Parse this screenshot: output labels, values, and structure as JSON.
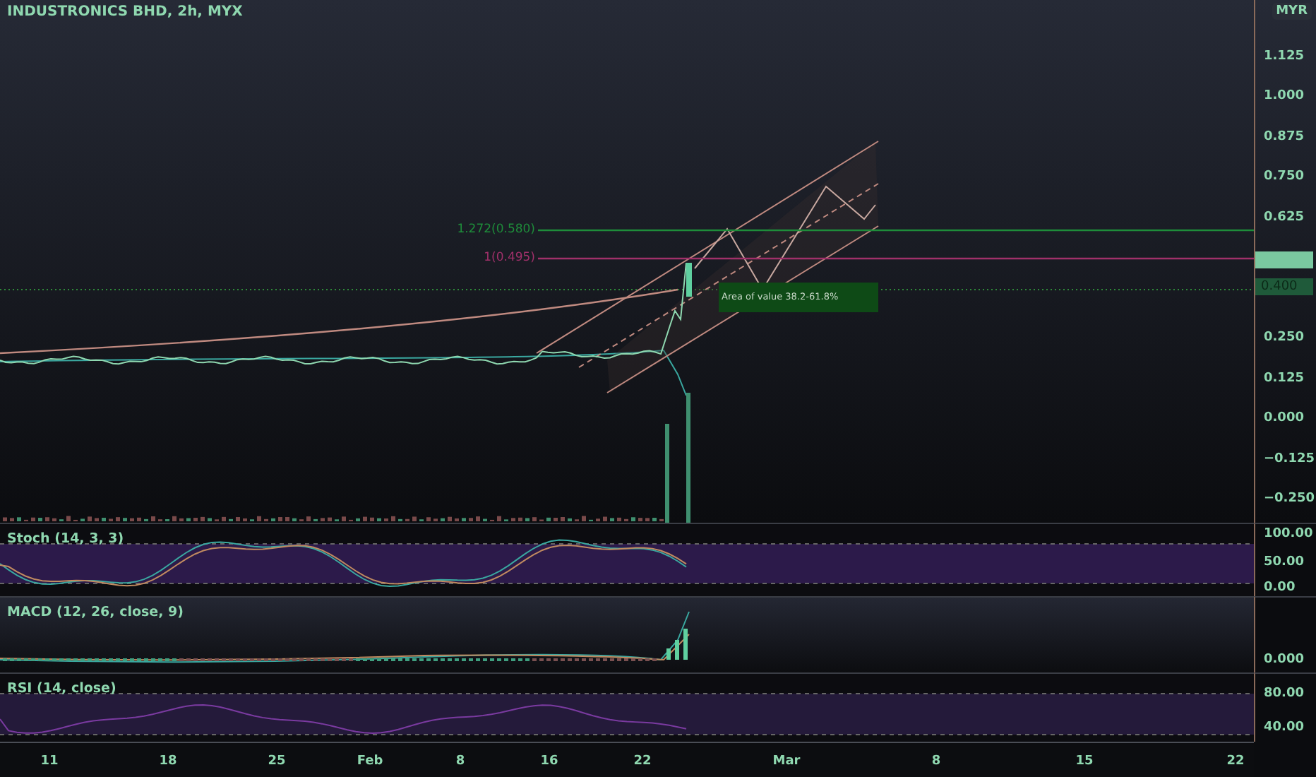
{
  "title": "INDUSTRONICS BHD, 2h, MYX",
  "currency": "MYR",
  "price_ticks": [
    "1.125",
    "1.000",
    "0.875",
    "0.750",
    "0.625",
    "0.250",
    "0.125",
    "0.000",
    "−0.125",
    "−0.250"
  ],
  "last_price": "0.400",
  "fib_levels": [
    {
      "label": "1.272(0.580)",
      "color": "#1e8c3a"
    },
    {
      "label": "1(0.495)",
      "color": "#a0306a"
    }
  ],
  "zone_label": "Area of value 38.2-61.8%",
  "panes": [
    {
      "kind": "stoch",
      "title": "Stoch (14, 3, 3)",
      "ticks": [
        "100.00",
        "50.00",
        "0.00"
      ]
    },
    {
      "kind": "macd",
      "title": "MACD (12, 26, close, 9)",
      "ticks": [
        "0.000"
      ]
    },
    {
      "kind": "rsi",
      "title": "RSI (14, close)",
      "ticks": [
        "80.00",
        "40.00"
      ]
    }
  ],
  "time_ticks": [
    "11",
    "18",
    "25",
    "Feb",
    "8",
    "16",
    "22",
    "Mar",
    "8",
    "15",
    "22"
  ]
}
